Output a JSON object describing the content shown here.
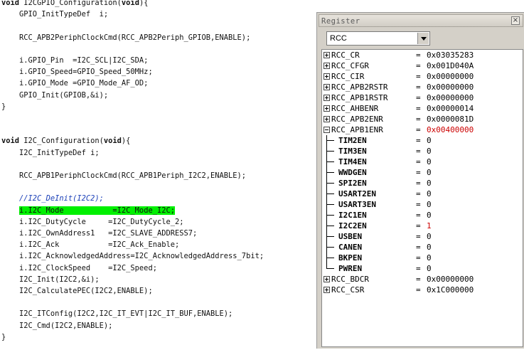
{
  "code": {
    "lines": [
      {
        "pre": "",
        "kw": "void",
        "post": " I2CGPIO_Configuration(",
        "kw2": "void",
        "post2": "){"
      },
      {
        "pre": "    GPIO_InitTypeDef  i;"
      },
      {
        "pre": ""
      },
      {
        "pre": "    RCC_APB2PeriphClockCmd(RCC_APB2Periph_GPIOB,ENABLE);"
      },
      {
        "pre": ""
      },
      {
        "pre": "    i.GPIO_Pin  =I2C_SCL|I2C_SDA;"
      },
      {
        "pre": "    i.GPIO_Speed=GPIO_Speed_50MHz;"
      },
      {
        "pre": "    i.GPIO_Mode =GPIO_Mode_AF_OD;"
      },
      {
        "pre": "    GPIO_Init(GPIOB,&i);"
      },
      {
        "pre": "}"
      },
      {
        "pre": ""
      },
      {
        "pre": ""
      },
      {
        "pre": "",
        "kw": "void",
        "post": " I2C_Configuration(",
        "kw2": "void",
        "post2": "){"
      },
      {
        "pre": "    I2C_InitTypeDef i;"
      },
      {
        "pre": ""
      },
      {
        "pre": "    RCC_APB1PeriphClockCmd(RCC_APB1Periph_I2C2,ENABLE);"
      },
      {
        "pre": ""
      },
      {
        "pre": "    ",
        "comment": "//I2C_DeInit(I2C2);"
      },
      {
        "pre": "    ",
        "highlight": "i.I2C_Mode           =I2C_Mode_I2C;"
      },
      {
        "pre": "    i.I2C_DutyCycle     =I2C_DutyCycle_2;"
      },
      {
        "pre": "    i.I2C_OwnAddress1   =I2C_SLAVE_ADDRESS7;"
      },
      {
        "pre": "    i.I2C_Ack           =I2C_Ack_Enable;"
      },
      {
        "pre": "    i.I2C_AcknowledgedAddress=I2C_AcknowledgedAddress_7bit;"
      },
      {
        "pre": "    i.I2C_ClockSpeed    =I2C_Speed;"
      },
      {
        "pre": "    I2C_Init(I2C2,&i);"
      },
      {
        "pre": "    I2C_CalculatePEC(I2C2,ENABLE);"
      },
      {
        "pre": ""
      },
      {
        "pre": "    I2C_ITConfig(I2C2,I2C_IT_EVT|I2C_IT_BUF,ENABLE);"
      },
      {
        "pre": "    I2C_Cmd(I2C2,ENABLE);"
      },
      {
        "pre": "}"
      }
    ]
  },
  "register_window": {
    "title": "Register",
    "close_icon": "close-icon",
    "peripheral_select": {
      "value": "RCC"
    },
    "registers": [
      {
        "name": "RCC_CR",
        "value": "0x03035283",
        "state": "collapsed"
      },
      {
        "name": "RCC_CFGR",
        "value": "0x001D040A",
        "state": "collapsed"
      },
      {
        "name": "RCC_CIR",
        "value": "0x00000000",
        "state": "collapsed"
      },
      {
        "name": "RCC_APB2RSTR",
        "value": "0x00000000",
        "state": "collapsed"
      },
      {
        "name": "RCC_APB1RSTR",
        "value": "0x00000000",
        "state": "collapsed"
      },
      {
        "name": "RCC_AHBENR",
        "value": "0x00000014",
        "state": "collapsed"
      },
      {
        "name": "RCC_APB2ENR",
        "value": "0x0000081D",
        "state": "collapsed"
      },
      {
        "name": "RCC_APB1ENR",
        "value": "0x00400000",
        "state": "expanded",
        "changed": true,
        "fields": [
          {
            "name": "TIM2EN",
            "value": "0"
          },
          {
            "name": "TIM3EN",
            "value": "0"
          },
          {
            "name": "TIM4EN",
            "value": "0"
          },
          {
            "name": "WWDGEN",
            "value": "0"
          },
          {
            "name": "SPI2EN",
            "value": "0"
          },
          {
            "name": "USART2EN",
            "value": "0"
          },
          {
            "name": "USART3EN",
            "value": "0"
          },
          {
            "name": "I2C1EN",
            "value": "0"
          },
          {
            "name": "I2C2EN",
            "value": "1",
            "changed": true
          },
          {
            "name": "USBEN",
            "value": "0"
          },
          {
            "name": "CANEN",
            "value": "0"
          },
          {
            "name": "BKPEN",
            "value": "0"
          },
          {
            "name": "PWREN",
            "value": "0"
          }
        ]
      },
      {
        "name": "RCC_BDCR",
        "value": "0x00000000",
        "state": "collapsed"
      },
      {
        "name": "RCC_CSR",
        "value": "0x1C000000",
        "state": "collapsed"
      }
    ],
    "equals_sign": "=",
    "colors": {
      "changed": "#cc0000",
      "highlight": "#00f000",
      "comment": "#1a3fb8"
    }
  }
}
